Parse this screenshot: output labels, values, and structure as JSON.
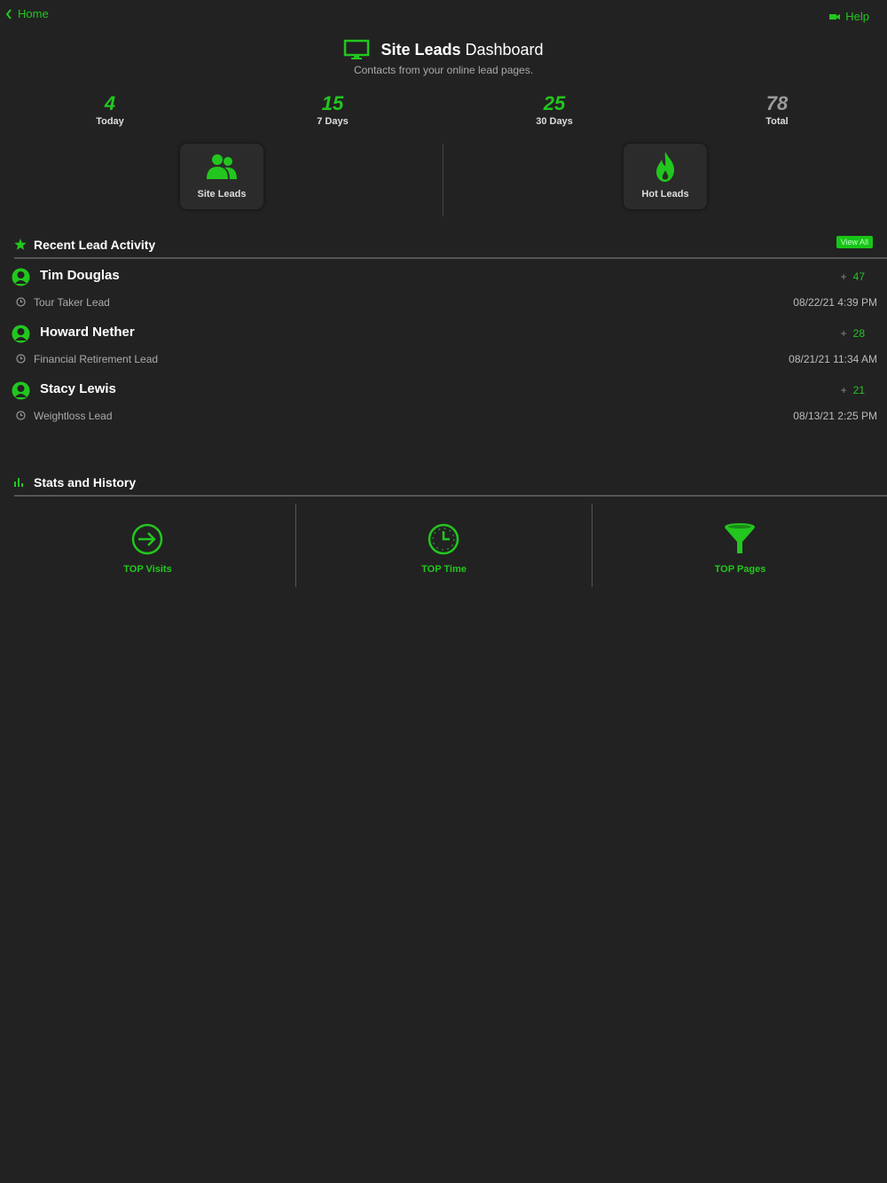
{
  "nav": {
    "home_label": "Home",
    "help_label": "Help"
  },
  "header": {
    "title_bold": "Site Leads",
    "title_rest": " Dashboard",
    "subtitle": "Contacts from your online lead pages."
  },
  "stats": [
    {
      "value": "4",
      "label": "Today"
    },
    {
      "value": "15",
      "label": "7 Days"
    },
    {
      "value": "25",
      "label": "30 Days"
    },
    {
      "value": "78",
      "label": "Total"
    }
  ],
  "tiles": [
    {
      "label": "Site Leads",
      "icon": "users-icon"
    },
    {
      "label": "Hot Leads",
      "icon": "flame-icon"
    }
  ],
  "recent": {
    "title": "Recent Lead Activity",
    "view_all": "View All",
    "leads": [
      {
        "name": "Tim Douglas",
        "plus": "+",
        "score": "47",
        "type": "Tour Taker Lead",
        "date": "08/22/21 4:39 PM"
      },
      {
        "name": "Howard Nether",
        "plus": "+",
        "score": "28",
        "type": "Financial Retirement Lead",
        "date": "08/21/21 11:34 AM"
      },
      {
        "name": "Stacy Lewis",
        "plus": "+",
        "score": "21",
        "type": "Weightloss Lead",
        "date": "08/13/21 2:25 PM"
      }
    ]
  },
  "history": {
    "title": "Stats and History",
    "items": [
      {
        "label": "TOP Visits",
        "icon": "enter-arrow-icon"
      },
      {
        "label": "TOP Time",
        "icon": "clock-icon"
      },
      {
        "label": "TOP Pages",
        "icon": "funnel-icon"
      }
    ]
  },
  "colors": {
    "accent": "#22c61e",
    "background": "#222222",
    "text": "#ffffff",
    "muted": "#aaaaaa"
  }
}
